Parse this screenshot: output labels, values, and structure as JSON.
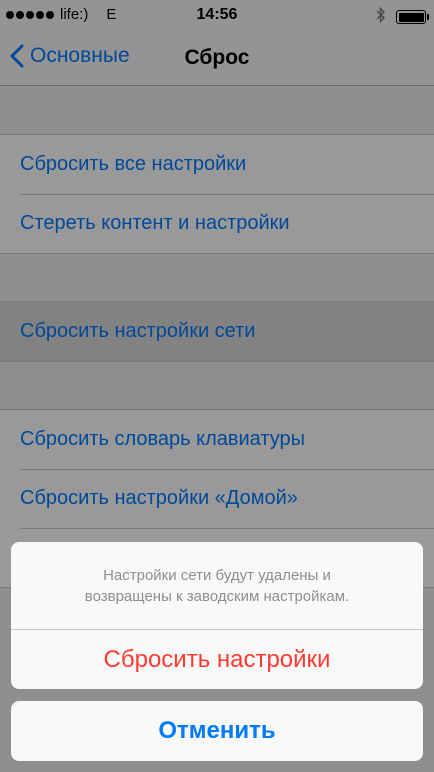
{
  "status_bar": {
    "carrier": "life:)",
    "network": "E",
    "time": "14:56",
    "signal_dots": 5
  },
  "nav": {
    "back_label": "Основные",
    "title": "Сброс"
  },
  "groups": [
    {
      "items": [
        {
          "label": "Сбросить все настройки"
        },
        {
          "label": "Стереть контент и настройки"
        }
      ]
    },
    {
      "items": [
        {
          "label": "Сбросить настройки сети"
        }
      ]
    },
    {
      "items": [
        {
          "label": "Сбросить словарь клавиатуры"
        },
        {
          "label": "Сбросить настройки «Домой»"
        },
        {
          "label": ""
        }
      ]
    }
  ],
  "action_sheet": {
    "message_line1": "Настройки сети будут удалены и",
    "message_line2": "возвращены к заводским настройкам.",
    "destructive_label": "Сбросить настройки",
    "cancel_label": "Отменить"
  },
  "colors": {
    "tint": "#007aff",
    "destructive": "#ff3b30"
  }
}
